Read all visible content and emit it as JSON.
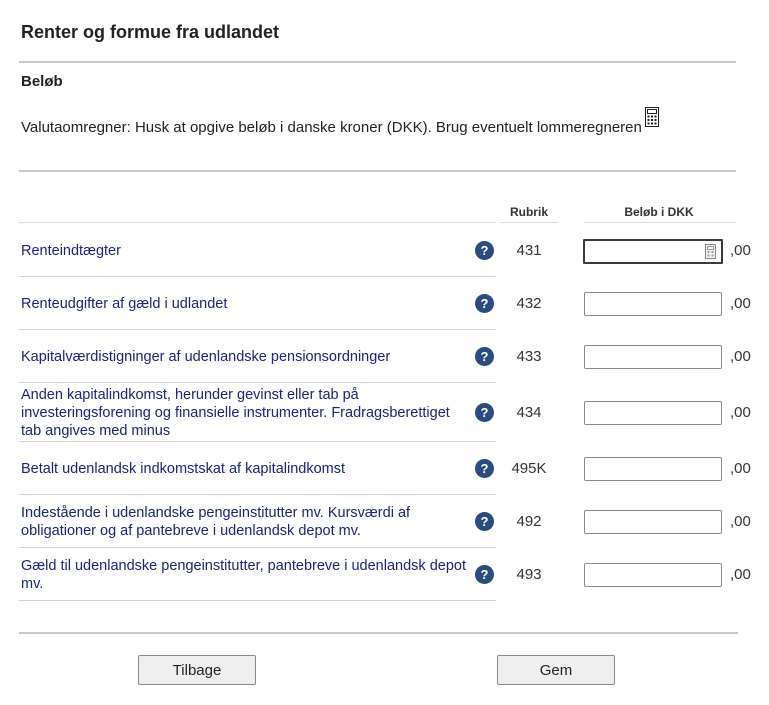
{
  "page": {
    "title": "Renter og formue fra udlandet",
    "section_title": "Beløb",
    "valuta_text": "Valutaomregner: Husk at opgive beløb i danske kroner (DKK). Brug eventuelt lommeregneren"
  },
  "table": {
    "headers": {
      "rubrik": "Rubrik",
      "amount": "Beløb i DKK"
    },
    "decimal_suffix": ",00",
    "help_glyph": "?",
    "rows": [
      {
        "label": "Renteindtægter",
        "rubrik": "431",
        "value": ""
      },
      {
        "label": "Renteudgifter af gæld i udlandet",
        "rubrik": "432",
        "value": ""
      },
      {
        "label": "Kapitalværdistigninger af udenlandske pensionsordninger",
        "rubrik": "433",
        "value": ""
      },
      {
        "label": "Anden kapitalindkomst, herunder gevinst eller tab på investeringsforening og finansielle instrumenter. Fradragsberettiget tab angives med minus",
        "rubrik": "434",
        "value": ""
      },
      {
        "label": "Betalt udenlandsk indkomstskat af kapitalindkomst",
        "rubrik": "495K",
        "value": ""
      },
      {
        "label": "Indestående i udenlandske pengeinstitutter mv. Kursværdi af obligationer og af pantebreve i udenlandsk depot mv.",
        "rubrik": "492",
        "value": ""
      },
      {
        "label": "Gæld til udenlandske pengeinstitutter, pantebreve i udenlandsk depot mv.",
        "rubrik": "493",
        "value": ""
      }
    ]
  },
  "buttons": {
    "back": "Tilbage",
    "save": "Gem"
  },
  "colors": {
    "label_link": "#1a237e",
    "help_icon_bg": "#2a4c7e",
    "divider": "#c8c8c8"
  },
  "icons": {
    "calculator": "calculator-icon",
    "help": "help-icon",
    "field_helper": "calculator-small-icon"
  }
}
